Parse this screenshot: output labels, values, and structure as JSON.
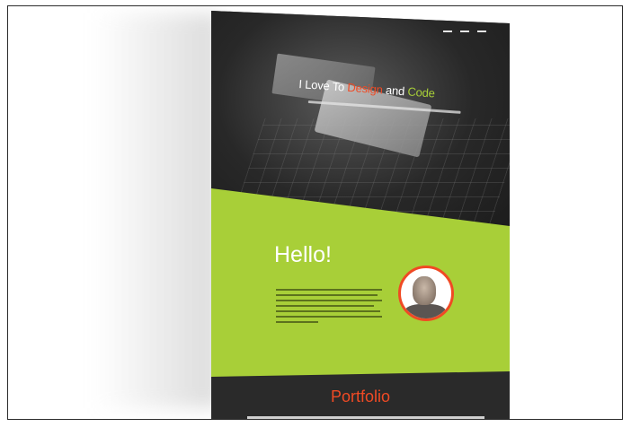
{
  "hero": {
    "heading_part1": "I Love To ",
    "heading_accent1": "Design",
    "heading_part2": " and ",
    "heading_accent2": "Code"
  },
  "about": {
    "title": "Hello!"
  },
  "portfolio": {
    "title": "Portfolio"
  },
  "colors": {
    "accent_green": "#a8cf38",
    "accent_red": "#f04a24",
    "dark": "#2a2a2a"
  },
  "icons": {
    "menu": "menu-dots-icon",
    "avatar": "profile-photo"
  }
}
